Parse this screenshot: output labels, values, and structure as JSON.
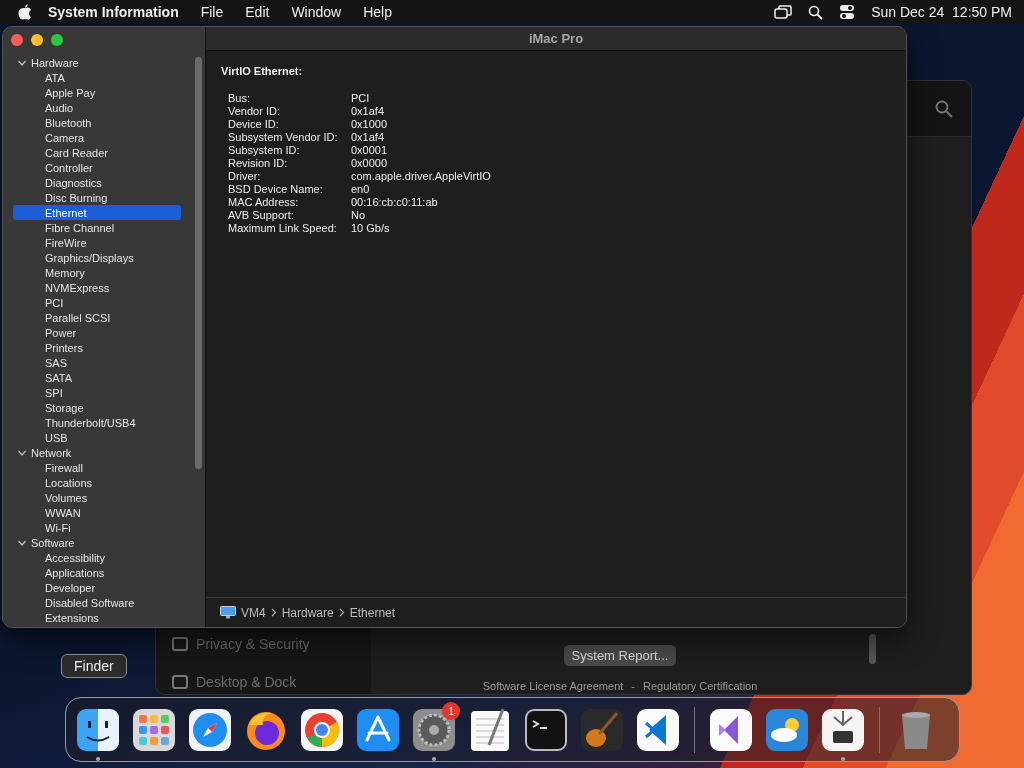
{
  "menu_bar": {
    "app_name": "System Information",
    "menus": [
      "File",
      "Edit",
      "Window",
      "Help"
    ],
    "clock": "Sun Dec 24  12:50 PM"
  },
  "background_window": {
    "sidebar_items": [
      "Privacy & Security",
      "Desktop & Dock"
    ],
    "button": "System Report...",
    "links": [
      "Software License Agreement",
      "-",
      "Regulatory Certification"
    ]
  },
  "window": {
    "title": "iMac Pro",
    "sidebar": [
      {
        "label": "Hardware",
        "expanded": true,
        "children": [
          {
            "label": "ATA",
            "selected": false
          },
          {
            "label": "Apple Pay",
            "selected": false
          },
          {
            "label": "Audio",
            "selected": false
          },
          {
            "label": "Bluetooth",
            "selected": false
          },
          {
            "label": "Camera",
            "selected": false
          },
          {
            "label": "Card Reader",
            "selected": false
          },
          {
            "label": "Controller",
            "selected": false
          },
          {
            "label": "Diagnostics",
            "selected": false
          },
          {
            "label": "Disc Burning",
            "selected": false
          },
          {
            "label": "Ethernet",
            "selected": true
          },
          {
            "label": "Fibre Channel",
            "selected": false
          },
          {
            "label": "FireWire",
            "selected": false
          },
          {
            "label": "Graphics/Displays",
            "selected": false
          },
          {
            "label": "Memory",
            "selected": false
          },
          {
            "label": "NVMExpress",
            "selected": false
          },
          {
            "label": "PCI",
            "selected": false
          },
          {
            "label": "Parallel SCSI",
            "selected": false
          },
          {
            "label": "Power",
            "selected": false
          },
          {
            "label": "Printers",
            "selected": false
          },
          {
            "label": "SAS",
            "selected": false
          },
          {
            "label": "SATA",
            "selected": false
          },
          {
            "label": "SPI",
            "selected": false
          },
          {
            "label": "Storage",
            "selected": false
          },
          {
            "label": "Thunderbolt/USB4",
            "selected": false
          },
          {
            "label": "USB",
            "selected": false
          }
        ]
      },
      {
        "label": "Network",
        "expanded": true,
        "children": [
          {
            "label": "Firewall",
            "selected": false
          },
          {
            "label": "Locations",
            "selected": false
          },
          {
            "label": "Volumes",
            "selected": false
          },
          {
            "label": "WWAN",
            "selected": false
          },
          {
            "label": "Wi-Fi",
            "selected": false
          }
        ]
      },
      {
        "label": "Software",
        "expanded": true,
        "children": [
          {
            "label": "Accessibility",
            "selected": false
          },
          {
            "label": "Applications",
            "selected": false
          },
          {
            "label": "Developer",
            "selected": false
          },
          {
            "label": "Disabled Software",
            "selected": false
          },
          {
            "label": "Extensions",
            "selected": false
          }
        ]
      }
    ],
    "detail": {
      "heading": "VirtIO Ethernet:",
      "rows": [
        {
          "label": "Bus:",
          "value": "PCI"
        },
        {
          "label": "Vendor ID:",
          "value": "0x1af4"
        },
        {
          "label": "Device ID:",
          "value": "0x1000"
        },
        {
          "label": "Subsystem Vendor ID:",
          "value": "0x1af4"
        },
        {
          "label": "Subsystem ID:",
          "value": "0x0001"
        },
        {
          "label": "Revision ID:",
          "value": "0x0000"
        },
        {
          "label": "Driver:",
          "value": "com.apple.driver.AppleVirtIO"
        },
        {
          "label": "BSD Device Name:",
          "value": "en0"
        },
        {
          "label": "MAC Address:",
          "value": "00:16:cb:c0:11:ab"
        },
        {
          "label": "AVB Support:",
          "value": "No"
        },
        {
          "label": "Maximum Link Speed:",
          "value": "10 Gb/s"
        }
      ]
    },
    "path": [
      "VM4",
      "Hardware",
      "Ethernet"
    ]
  },
  "dock": {
    "tooltip": "Finder",
    "apps": [
      {
        "kind": "finder",
        "running": true
      },
      {
        "kind": "launchpad",
        "running": false
      },
      {
        "kind": "safari",
        "running": false
      },
      {
        "kind": "firefox",
        "running": false
      },
      {
        "kind": "chrome",
        "running": false
      },
      {
        "kind": "appstore",
        "running": false
      },
      {
        "kind": "settings",
        "running": true,
        "badge": "1"
      },
      {
        "kind": "textedit",
        "running": false
      },
      {
        "kind": "terminal",
        "running": false
      },
      {
        "kind": "garageband",
        "running": false
      },
      {
        "kind": "vscode",
        "running": false
      },
      {
        "kind": "separator"
      },
      {
        "kind": "visualstudio",
        "running": false
      },
      {
        "kind": "weather",
        "running": false
      },
      {
        "kind": "sysinfo",
        "running": true
      },
      {
        "kind": "separator"
      },
      {
        "kind": "trash",
        "running": false
      }
    ]
  }
}
